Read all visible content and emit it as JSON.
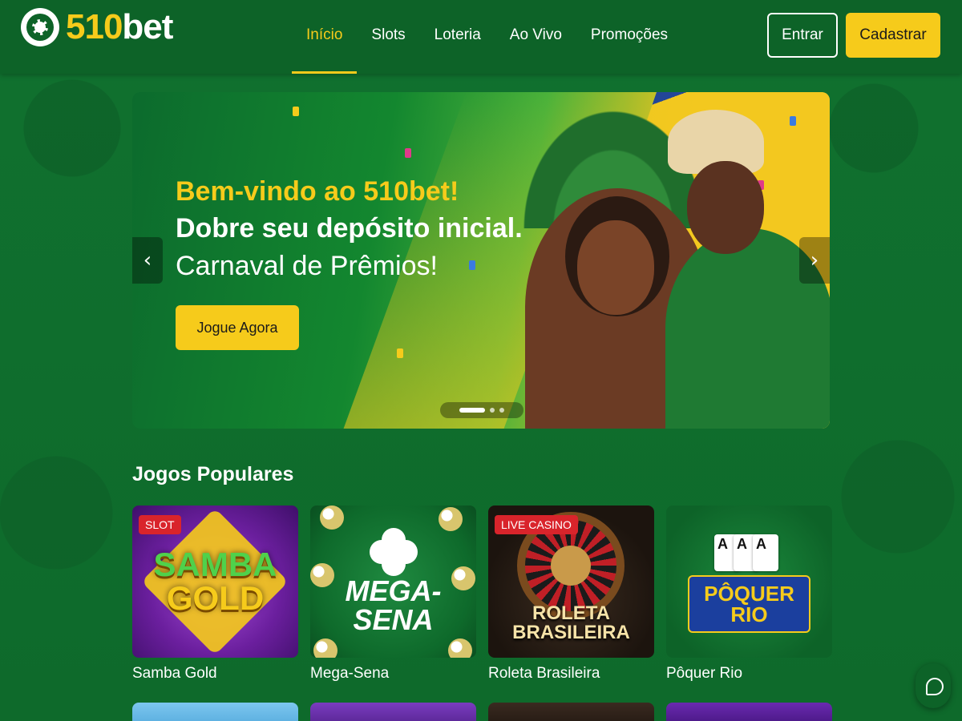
{
  "brand": {
    "logo_num": "510",
    "logo_word": "bet"
  },
  "nav": {
    "items": [
      {
        "label": "Início",
        "active": true
      },
      {
        "label": "Slots",
        "active": false
      },
      {
        "label": "Loteria",
        "active": false
      },
      {
        "label": "Ao Vivo",
        "active": false
      },
      {
        "label": "Promoções",
        "active": false
      }
    ]
  },
  "auth": {
    "login_label": "Entrar",
    "register_label": "Cadastrar"
  },
  "banner": {
    "line1": "Bem-vindo ao 510bet!",
    "line2": "Dobre seu depósito inicial.",
    "line3": "Carnaval de Prêmios!",
    "cta_label": "Jogue Agora",
    "prev_icon": "chevron-left-icon",
    "next_icon": "chevron-right-icon",
    "prev_glyph": "‹",
    "next_glyph": "›",
    "slide_count": 3,
    "active_slide": 1
  },
  "popular": {
    "title": "Jogos Populares",
    "games": [
      {
        "label": "Samba Gold",
        "badge": "SLOT",
        "art_line1": "SAMBA",
        "art_line2": "GOLD"
      },
      {
        "label": "Mega-Sena",
        "badge": "",
        "art_line1": "MEGA-SENA"
      },
      {
        "label": "Roleta Brasileira",
        "badge": "LIVE CASINO",
        "art_line1": "ROLETA",
        "art_line2": "BRASILEIRA"
      },
      {
        "label": "Pôquer Rio",
        "badge": "",
        "art_line1": "PÔQUER",
        "art_line2": "RIO",
        "cards": [
          "A",
          "A",
          "A"
        ]
      }
    ]
  },
  "chat": {
    "icon": "chat-bubble-icon"
  },
  "colors": {
    "brand_green": "#0d6328",
    "accent_yellow": "#f6cb1b",
    "badge_red": "#d9242b"
  }
}
